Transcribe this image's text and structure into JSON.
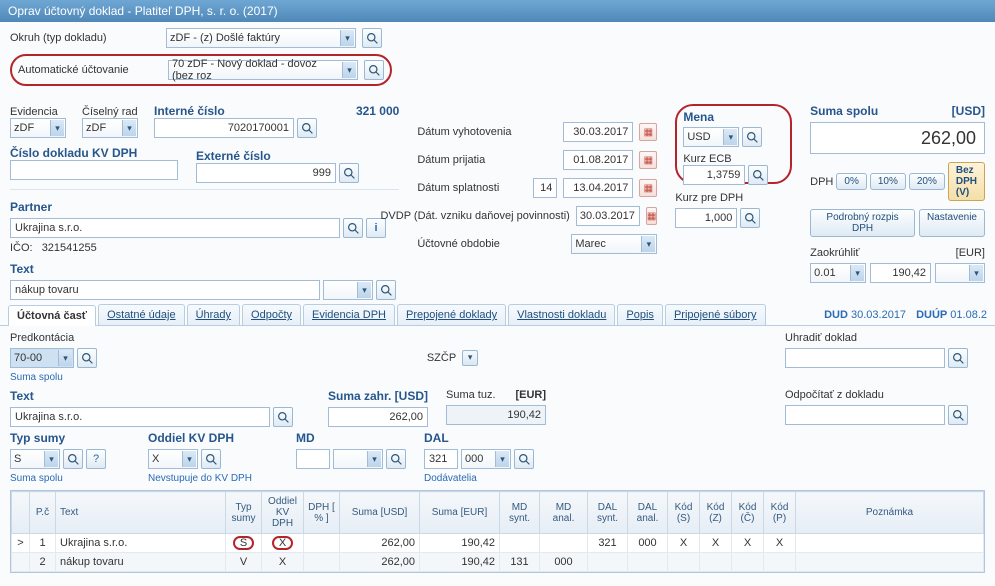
{
  "title": "Oprav účtovný doklad - Platiteľ DPH, s. r. o. (2017)",
  "header": {
    "okruh_label": "Okruh (typ dokladu)",
    "okruh_value": "zDF - (z) Došlé faktúry",
    "auto_label": "Automatické účtovanie",
    "auto_value": "70 zDF - Nový doklad - dovoz (bez roz"
  },
  "docinfo": {
    "evidencia_label": "Evidencia",
    "evidencia_value": "zDF",
    "ciselny_rad_label": "Číselný rad",
    "ciselny_rad_value": "zDF",
    "interne_label": "Interné číslo",
    "interne_counter": "321 000",
    "interne_value": "7020170001",
    "cislo_kv_label": "Číslo dokladu KV DPH",
    "externe_label": "Externé číslo",
    "externe_value": "999",
    "partner_label": "Partner",
    "partner_value": "Ukrajina s.r.o.",
    "ico_label": "IČO:",
    "ico_value": "321541255",
    "text_label": "Text",
    "text_value": "nákup tovaru"
  },
  "dates": {
    "vyhotovenia_label": "Dátum vyhotovenia",
    "vyhotovenia_value": "30.03.2017",
    "prijatia_label": "Dátum prijatia",
    "prijatia_value": "01.08.2017",
    "splatnosti_label": "Dátum splatnosti",
    "splatnosti_days": "14",
    "splatnosti_value": "13.04.2017",
    "dvdp_label": "DVDP (Dát. vzniku daňovej povinnosti)",
    "dvdp_value": "30.03.2017",
    "obdobie_label": "Účtovné obdobie",
    "obdobie_value": "Marec"
  },
  "currency": {
    "mena_label": "Mena",
    "mena_value": "USD",
    "kurz_ecb_label": "Kurz ECB",
    "kurz_ecb_value": "1,3759",
    "kurz_pre_dph_label": "Kurz pre DPH",
    "kurz_pre_dph_value": "1,000"
  },
  "totals": {
    "suma_label": "Suma spolu",
    "currency_tag": "[USD]",
    "amount": "262,00",
    "dph_label": "DPH",
    "btn0": "0%",
    "btn10": "10%",
    "btn20": "20%",
    "bez_dph": "Bez DPH (V)",
    "rozpis_btn": "Podrobný rozpis DPH",
    "nastav_btn": "Nastavenie",
    "zaokruhl_label": "Zaokrúhliť",
    "zaokruhl_cur": "[EUR]",
    "zaokruhl_step": "0.01",
    "zaokruhl_value": "190,42"
  },
  "tabs": {
    "uctovna": "Účtovná časť",
    "ostatne": "Ostatné údaje",
    "uhrady": "Úhrady",
    "odpocty": "Odpočty",
    "evdph": "Evidencia DPH",
    "prepojene": "Prepojené doklady",
    "vlastnosti": "Vlastnosti dokladu",
    "popis": "Popis",
    "subory": "Pripojené súbory",
    "dud": "DUD",
    "dud_date": "30.03.2017",
    "duup": "DUÚP",
    "duup_date": "01.08.2"
  },
  "predkont": {
    "label": "Predkontácia",
    "value": "70-00",
    "suma_link": "Suma spolu",
    "szcp": "SZČP"
  },
  "uhradit": {
    "label": "Uhradiť doklad",
    "odpocitat": "Odpočítať z dokladu"
  },
  "line": {
    "text_label": "Text",
    "text_value": "Ukrajina s.r.o.",
    "suma_zahr_label": "Suma zahr.",
    "suma_zahr_cur": "[USD]",
    "suma_zahr_value": "262,00",
    "suma_tuz_label": "Suma tuz.",
    "suma_tuz_cur": "[EUR]",
    "suma_tuz_value": "190,42",
    "typ_sumy_label": "Typ sumy",
    "typ_sumy_value": "S",
    "oddiel_label": "Oddiel KV DPH",
    "oddiel_value": "X",
    "oddiel_hint": "Nevstupuje do KV DPH",
    "md_label": "MD",
    "dal_label": "DAL",
    "dal_acc": "321",
    "dal_anal": "000",
    "dal_hint": "Dodávatelia"
  },
  "gridcols": {
    "pc": "P.č",
    "text": "Text",
    "typ": "Typ sumy",
    "oddiel": "Oddiel KV DPH",
    "dph": "DPH [ % ]",
    "suma_usd": "Suma [USD]",
    "suma_eur": "Suma [EUR]",
    "md_synt": "MD synt.",
    "md_anal": "MD anal.",
    "dal_synt": "DAL synt.",
    "dal_anal": "DAL anal.",
    "kod_s": "Kód (S)",
    "kod_z": "Kód (Z)",
    "kod_c": "Kód (Č)",
    "kod_p": "Kód (P)",
    "poznamka": "Poznámka"
  },
  "gridrows": [
    {
      "pc": "1",
      "text": "Ukrajina s.r.o.",
      "typ": "S",
      "oddiel": "X",
      "dph": "",
      "usd": "262,00",
      "eur": "190,42",
      "mds": "",
      "mda": "",
      "dals": "321",
      "dala": "000",
      "ks": "X",
      "kz": "X",
      "kc": "X",
      "kp": "X",
      "pozn": ""
    },
    {
      "pc": "2",
      "text": "nákup tovaru",
      "typ": "V",
      "oddiel": "X",
      "dph": "",
      "usd": "262,00",
      "eur": "190,42",
      "mds": "131",
      "mda": "000",
      "dals": "",
      "dala": "",
      "ks": "",
      "kz": "",
      "kc": "",
      "kp": "",
      "pozn": ""
    }
  ]
}
